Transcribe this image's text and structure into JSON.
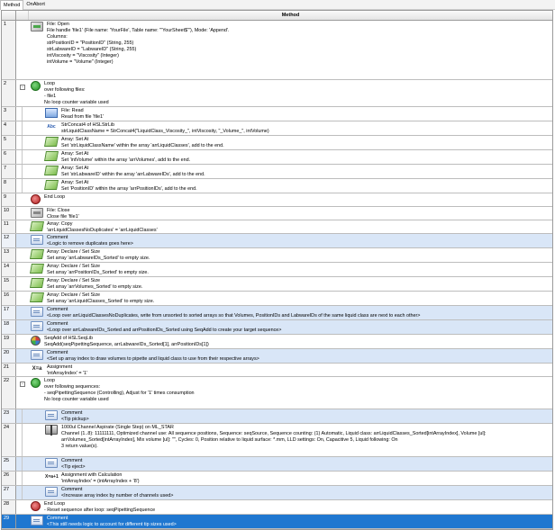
{
  "tabs": [
    {
      "label": "Method"
    },
    {
      "label": "OnAbort"
    }
  ],
  "grid": {
    "column_title": "Method"
  },
  "rows": [
    {
      "num": "1",
      "icon": "file-open-icon",
      "lines": [
        "File: Open",
        "File handle 'file1' (File name: 'YourFile', Table name: '\"YourSheet$\"'), Mode: 'Append'.",
        "Columns:",
        "strPositionID = \"PositionID\" (String, 255)",
        "strLabwareID = \"LabwareID\" (String, 255)",
        "intViscosity = \"Viscosity\" (Integer)",
        "intVolume = \"Volume\" (Integer)"
      ]
    },
    {
      "num": "2",
      "icon": "loop-icon",
      "lines": [
        "Loop",
        "over following files:",
        "- file1",
        "No loop counter variable used"
      ]
    },
    {
      "num": "3",
      "icon": "file-read-icon",
      "lines": [
        "File: Read",
        "Read from file 'file1'"
      ]
    },
    {
      "num": "4",
      "icon": "string-concat-icon",
      "lines": [
        "StrConcat4 of HSLStrLib",
        "strLiquidClassName = StrConcat4(\"LiquidClass_Viscosity_\", intViscosity, \"_Volume_\", intVolume)"
      ]
    },
    {
      "num": "5",
      "icon": "array-set-icon",
      "lines": [
        "Array: Set At",
        "Set 'strLiquidClassName' within the array 'arrLiquidClasses', add to the end."
      ]
    },
    {
      "num": "6",
      "icon": "array-set-icon",
      "lines": [
        "Array: Set At",
        "Set 'intVolume' within the array 'arrVolumes', add to the end."
      ]
    },
    {
      "num": "7",
      "icon": "array-set-icon",
      "lines": [
        "Array: Set At",
        "Set 'strLabwareID' within the array 'arrLabwareIDs', add to the end."
      ]
    },
    {
      "num": "8",
      "icon": "array-set-icon",
      "lines": [
        "Array: Set At",
        "Set 'PositionID' within the array 'arrPositionIDs', add to the end."
      ]
    },
    {
      "num": "9",
      "icon": "end-loop-icon",
      "lines": [
        "End Loop"
      ]
    },
    {
      "num": "10",
      "icon": "file-close-icon",
      "lines": [
        "File: Close",
        "Close file 'file1'"
      ]
    },
    {
      "num": "11",
      "icon": "array-copy-icon",
      "lines": [
        "Array: Copy",
        "'arrLiquidClassesNoDuplicates' = 'arrLiquidClasses'"
      ]
    },
    {
      "num": "12",
      "icon": "comment-icon",
      "lines": [
        "Comment",
        "<Logic to remove duplicates goes here>"
      ]
    },
    {
      "num": "13",
      "icon": "array-declare-icon",
      "lines": [
        "Array: Declare / Set Size",
        "Set array 'arrLabwareIDs_Sorted' to empty size."
      ]
    },
    {
      "num": "14",
      "icon": "array-declare-icon",
      "lines": [
        "Array: Declare / Set Size",
        "Set array 'arrPositionIDs_Sorted' to empty size."
      ]
    },
    {
      "num": "15",
      "icon": "array-declare-icon",
      "lines": [
        "Array: Declare / Set Size",
        "Set array 'arrVolumes_Sorted' to empty size."
      ]
    },
    {
      "num": "16",
      "icon": "array-declare-icon",
      "lines": [
        "Array: Declare / Set Size",
        "Set array 'arrLiquidClasses_Sorted' to empty size."
      ]
    },
    {
      "num": "17",
      "icon": "comment-icon",
      "lines": [
        "Comment",
        "<Loop over arrLiquidClassesNoDuplicates, write from unsorted to sorted arrays so that Volumes, PositionIDs and LabwareIDs of the same liquid class are next to each other>"
      ]
    },
    {
      "num": "18",
      "icon": "comment-icon",
      "lines": [
        "Comment",
        "<Loop over arrLabwareIDs_Sorted and arrPositionIDs_Sorted using SeqAdd to create your target sequence>"
      ]
    },
    {
      "num": "19",
      "icon": "seqadd-icon",
      "lines": [
        "SeqAdd of HSLSeqLib",
        "SeqAdd(seqPipettingSequence, arrLabwareIDs_Sorted[1], arrPositionIDs[1])"
      ]
    },
    {
      "num": "20",
      "icon": "comment-icon",
      "lines": [
        "Comment",
        "<Set up array index to draw volumes to pipette and liquid class to use from their respective arrays>"
      ]
    },
    {
      "num": "21",
      "icon": "assignment-icon",
      "lines": [
        "Assignment",
        "'intArrayIndex' = '1'"
      ]
    },
    {
      "num": "22",
      "icon": "loop-icon",
      "lines": [
        "Loop",
        "over following sequences:",
        "  - seqPipettingSequence (Controlling), Adjust for '1' times consumption",
        "No loop counter variable used"
      ]
    },
    {
      "num": "23",
      "icon": "comment-icon",
      "lines": [
        "Comment",
        "<Tip pickup>"
      ]
    },
    {
      "num": "24",
      "icon": "aspirate-icon",
      "lines": [
        "1000ul Channel Aspirate (Single Step) on ML_STAR",
        "Channel (1..8): 11111111, Optimized channel use: All sequence positions, Sequence: seqSource, Sequence counting: (1) Automatic, Liquid class: arrLiquidClasses_Sorted[intArrayIndex], Volume [ul]:",
        "arrVolumes_Sorted[intArrayIndex], Mix volume [ul]: \"\", Cycles: 0, Position relative to liquid surface: *.mm, LLD settings: On, Capacitive 5, Liquid following: On",
        "3 return value(s)."
      ]
    },
    {
      "num": "25",
      "icon": "comment-icon",
      "lines": [
        "Comment",
        "<Tip eject>"
      ]
    },
    {
      "num": "26",
      "icon": "calculation-icon",
      "lines": [
        "Assignment with Calculation",
        "'intArrayIndex' = (intArrayIndex + '8')"
      ]
    },
    {
      "num": "27",
      "icon": "comment-icon",
      "lines": [
        "Comment",
        "<Increase array index by number of channels used>"
      ]
    },
    {
      "num": "28",
      "icon": "end-loop-icon",
      "lines": [
        "End Loop",
        "- Reset sequence after loop: seqPipettingSequence"
      ]
    },
    {
      "num": "29",
      "icon": "comment-icon",
      "lines": [
        "Comment",
        "<This still needs logic to account for different tip sizes used>"
      ]
    }
  ],
  "colors": {
    "comment_row": "#d9e6f7",
    "selected_row": "#1f77d0",
    "header_bg": "#e4e4e4"
  }
}
